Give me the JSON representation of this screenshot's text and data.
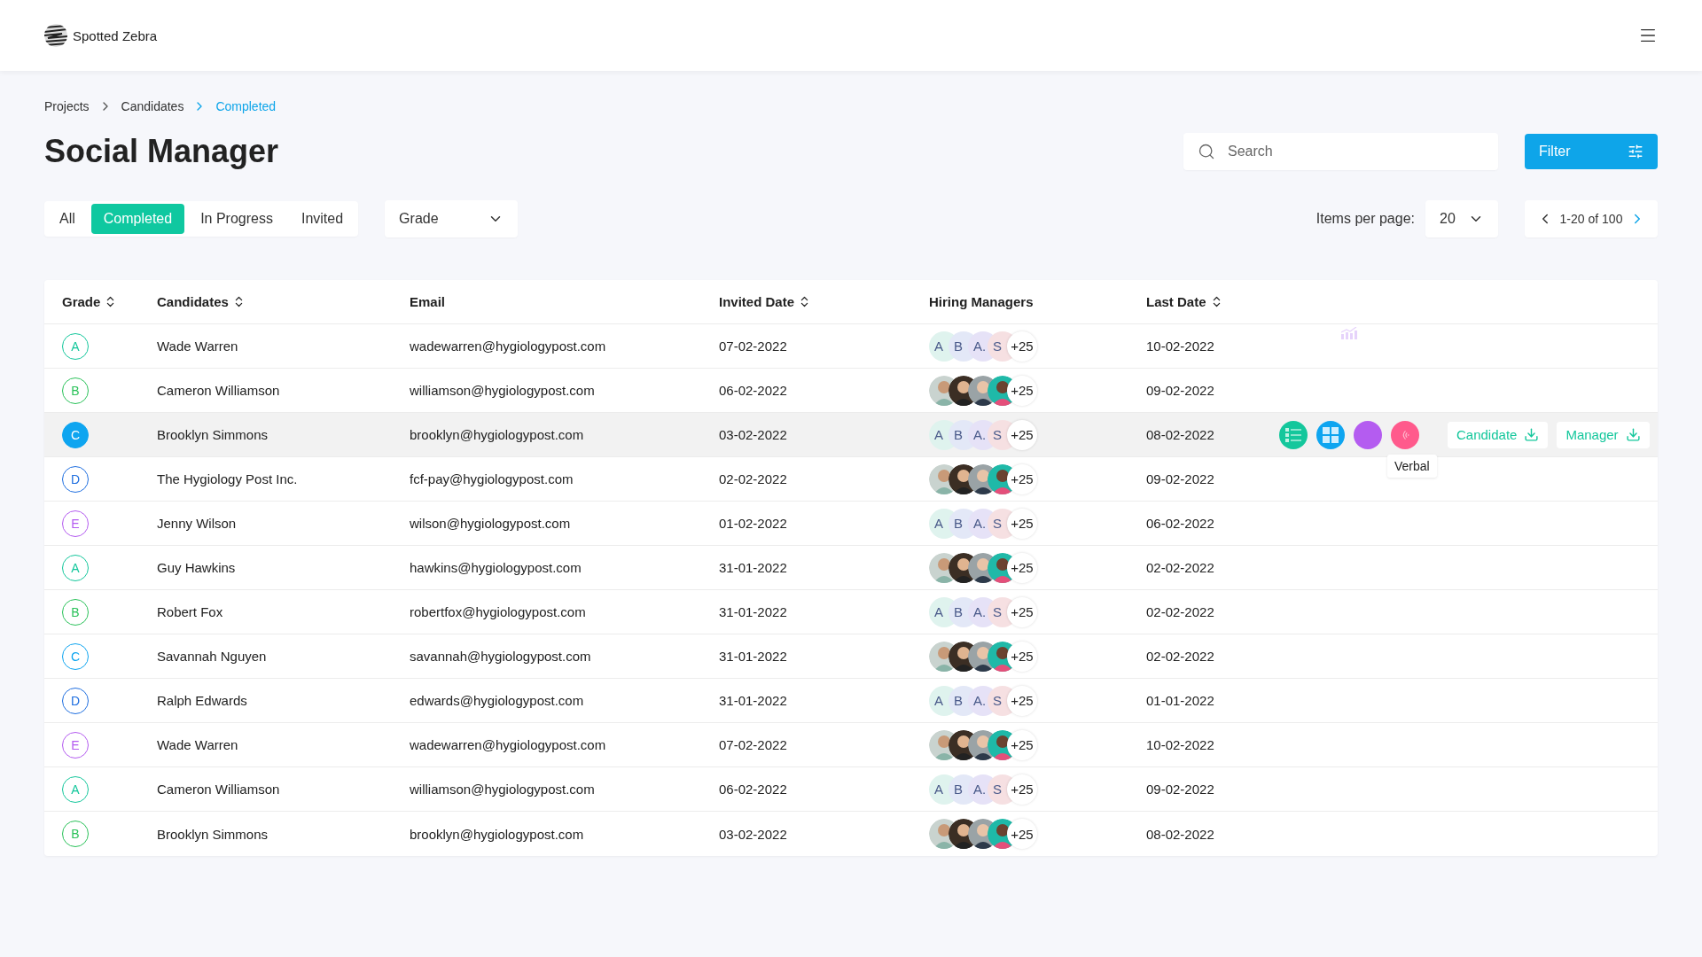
{
  "header": {
    "brand": "Spotted Zebra"
  },
  "breadcrumb": [
    {
      "label": "Projects",
      "current": false
    },
    {
      "label": "Candidates",
      "current": false
    },
    {
      "label": "Completed",
      "current": true
    }
  ],
  "title": "Social Manager",
  "search": {
    "placeholder": "Search"
  },
  "filter_button": "Filter",
  "status_tabs": [
    {
      "label": "All",
      "selected": false
    },
    {
      "label": "Completed",
      "selected": true
    },
    {
      "label": "In Progress",
      "selected": false
    },
    {
      "label": "Invited",
      "selected": false
    }
  ],
  "grade_dropdown": {
    "value": "Grade"
  },
  "pagination": {
    "items_label": "Items per page:",
    "per_page": "20",
    "range": "1-20 of 100"
  },
  "table": {
    "columns": [
      {
        "label": "Grade",
        "sortable": true
      },
      {
        "label": "Candidates",
        "sortable": true
      },
      {
        "label": "Email",
        "sortable": false
      },
      {
        "label": "Invited Date",
        "sortable": true
      },
      {
        "label": "Hiring Managers",
        "sortable": false
      },
      {
        "label": "Last Date",
        "sortable": true
      }
    ],
    "rows": [
      {
        "grade": "A",
        "color": "#14c79c",
        "candidate": "Wade Warren",
        "email": "wadewarren@hygiologypost.com",
        "invited": "07-02-2022",
        "managers": [
          {
            "kind": "initials",
            "label": "A",
            "color": "#dff3ee"
          },
          {
            "kind": "initials",
            "label": "B",
            "color": "#e3e8f7"
          },
          {
            "kind": "initials",
            "label": "A.",
            "color": "#e6e2f7"
          },
          {
            "kind": "initials",
            "label": "S",
            "color": "#f6e0e2"
          }
        ],
        "more": "+25",
        "last": "10-02-2022",
        "selected": false,
        "trend_icon": true
      },
      {
        "grade": "B",
        "color": "#2bc25a",
        "candidate": "Cameron Williamson",
        "email": "williamson@hygiologypost.com",
        "invited": "06-02-2022",
        "more": "+25",
        "last": "09-02-2022",
        "selected": false
      },
      {
        "grade": "C",
        "color": "#0ea5f0",
        "candidate": "Brooklyn Simmons",
        "email": "brooklyn@hygiologypost.com",
        "invited": "03-02-2022",
        "managers": [
          {
            "kind": "initials",
            "label": "A",
            "color": "#dff3ee"
          },
          {
            "kind": "initials",
            "label": "B",
            "color": "#e3e8f7"
          },
          {
            "kind": "initials",
            "label": "A.",
            "color": "#e6e2f7"
          },
          {
            "kind": "initials",
            "label": "S",
            "color": "#f6e0e2"
          }
        ],
        "more": "+25",
        "last": "08-02-2022",
        "selected": true
      },
      {
        "grade": "D",
        "color": "#1f6fe0",
        "candidate": "The Hygiology Post Inc.",
        "email": "fcf-pay@hygiologypost.com",
        "invited": "02-02-2022",
        "more": "+25",
        "last": "09-02-2022",
        "selected": false
      },
      {
        "grade": "E",
        "color": "#b45cf0",
        "candidate": "Jenny Wilson",
        "email": "wilson@hygiologypost.com",
        "invited": "01-02-2022",
        "managers": [
          {
            "kind": "initials",
            "label": "A",
            "color": "#dff3ee"
          },
          {
            "kind": "initials",
            "label": "B",
            "color": "#e3e8f7"
          },
          {
            "kind": "initials",
            "label": "A.",
            "color": "#e6e2f7"
          },
          {
            "kind": "initials",
            "label": "S",
            "color": "#f6e0e2"
          }
        ],
        "more": "+25",
        "last": "06-02-2022",
        "selected": false
      },
      {
        "grade": "A",
        "color": "#14c79c",
        "candidate": "Guy Hawkins",
        "email": "hawkins@hygiologypost.com",
        "invited": "31-01-2022",
        "more": "+25",
        "last": "02-02-2022",
        "selected": false
      },
      {
        "grade": "B",
        "color": "#2bc25a",
        "candidate": "Robert Fox",
        "email": "robertfox@hygiologypost.com",
        "invited": "31-01-2022",
        "managers": [
          {
            "kind": "initials",
            "label": "A",
            "color": "#dff3ee"
          },
          {
            "kind": "initials",
            "label": "B",
            "color": "#e3e8f7"
          },
          {
            "kind": "initials",
            "label": "A.",
            "color": "#e6e2f7"
          },
          {
            "kind": "initials",
            "label": "S",
            "color": "#f6e0e2"
          }
        ],
        "more": "+25",
        "last": "02-02-2022",
        "selected": false
      },
      {
        "grade": "C",
        "color": "#0ea5f0",
        "candidate": "Savannah Nguyen",
        "email": "savannah@hygiologypost.com",
        "invited": "31-01-2022",
        "more": "+25",
        "last": "02-02-2022",
        "selected": false
      },
      {
        "grade": "D",
        "color": "#1f6fe0",
        "candidate": "Ralph Edwards",
        "email": "edwards@hygiologypost.com",
        "invited": "31-01-2022",
        "managers": [
          {
            "kind": "initials",
            "label": "A",
            "color": "#dff3ee"
          },
          {
            "kind": "initials",
            "label": "B",
            "color": "#e3e8f7"
          },
          {
            "kind": "initials",
            "label": "A.",
            "color": "#e6e2f7"
          },
          {
            "kind": "initials",
            "label": "S",
            "color": "#f6e0e2"
          }
        ],
        "more": "+25",
        "last": "01-01-2022",
        "selected": false
      },
      {
        "grade": "E",
        "color": "#b45cf0",
        "candidate": "Wade Warren",
        "email": "wadewarren@hygiologypost.com",
        "invited": "07-02-2022",
        "more": "+25",
        "last": "10-02-2022",
        "selected": false
      },
      {
        "grade": "A",
        "color": "#14c79c",
        "candidate": "Cameron Williamson",
        "email": "williamson@hygiologypost.com",
        "invited": "06-02-2022",
        "managers": [
          {
            "kind": "initials",
            "label": "A",
            "color": "#dff3ee"
          },
          {
            "kind": "initials",
            "label": "B",
            "color": "#e3e8f7"
          },
          {
            "kind": "initials",
            "label": "A.",
            "color": "#e6e2f7"
          },
          {
            "kind": "initials",
            "label": "S",
            "color": "#f6e0e2"
          }
        ],
        "more": "+25",
        "last": "09-02-2022",
        "selected": false
      },
      {
        "grade": "B",
        "color": "#2bc25a",
        "candidate": "Brooklyn Simmons",
        "email": "brooklyn@hygiologypost.com",
        "invited": "03-02-2022",
        "more": "+25",
        "last": "08-02-2022",
        "selected": false
      }
    ]
  },
  "row_actions": {
    "icons": [
      {
        "kind": "list",
        "color": "#14c79c"
      },
      {
        "kind": "puzzle",
        "color": "#0ea5f0"
      },
      {
        "kind": "plain",
        "color": "#b45cf0"
      },
      {
        "kind": "verbal",
        "color": "#ff5a8c"
      }
    ],
    "tooltip": "Verbal",
    "buttons": [
      "Candidate",
      "Manager"
    ]
  }
}
